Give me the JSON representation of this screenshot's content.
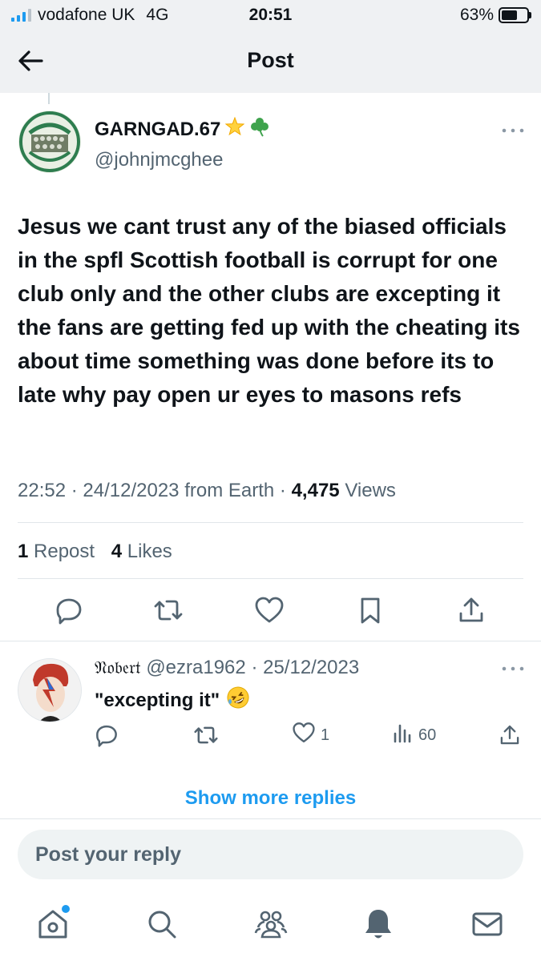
{
  "status_bar": {
    "carrier": "vodafone UK",
    "network": "4G",
    "time": "20:51",
    "battery": "63%",
    "battery_level": 0.63
  },
  "header": {
    "title": "Post"
  },
  "post": {
    "author_name": "GARNGAD.67",
    "author_emojis": [
      "star-icon",
      "shamrock-icon"
    ],
    "author_handle": "@johnjmcghee",
    "text": "Jesus we cant trust any of the biased officials in the spfl Scottish football is corrupt for one club only and the other clubs are excepting it the fans are getting fed up with the cheating its about time something was done before its to late why pay open ur eyes to masons refs",
    "time": "22:52",
    "date": "24/12/2023",
    "source": "from Earth",
    "views_count": "4,475",
    "views_label": "Views",
    "repost_count": "1",
    "repost_label": "Repost",
    "likes_count": "4",
    "likes_label": "Likes"
  },
  "reply": {
    "name": "𝔑𝔬𝔟𝔢𝔯𝔱",
    "handle": "@ezra1962",
    "date": "25/12/2023",
    "text": "\"excepting it\"",
    "emoji": "rofl-emoji",
    "likes": "1",
    "views": "60"
  },
  "show_more": "Show more replies",
  "reply_input": {
    "placeholder": "Post your reply"
  },
  "colors": {
    "accent": "#1d9bf0",
    "text": "#0f1419",
    "muted": "#536471"
  }
}
